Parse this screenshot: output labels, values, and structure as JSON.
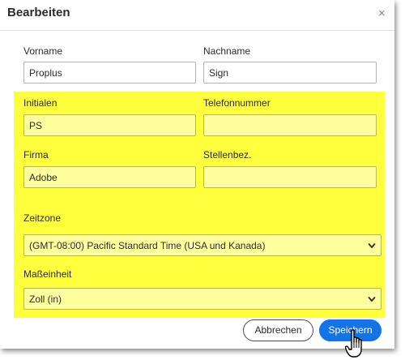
{
  "dialog": {
    "title": "Bearbeiten",
    "close_glyph": "×"
  },
  "form": {
    "vorname": {
      "label": "Vorname",
      "value": "Proplus"
    },
    "nachname": {
      "label": "Nachname",
      "value": "Sign"
    },
    "initialen": {
      "label": "Initialen",
      "value": "PS"
    },
    "telefonnummer": {
      "label": "Telefonnummer",
      "value": ""
    },
    "firma": {
      "label": "Firma",
      "value": "Adobe"
    },
    "stellenbez": {
      "label": "Stellenbez.",
      "value": ""
    },
    "zeitzone": {
      "label": "Zeitzone",
      "value": "(GMT-08:00) Pacific Standard Time (USA und Kanada)"
    },
    "masseinheit": {
      "label": "Maßeinheit",
      "value": "Zoll (in)"
    }
  },
  "buttons": {
    "cancel_label": "Abbrechen",
    "save_label": "Speichern"
  },
  "colors": {
    "highlight": "#ffff3e",
    "highlight_field": "#ffff9e",
    "primary": "#1473e6"
  },
  "icons": {
    "close": "close-icon",
    "dropdown": "chevron-down-icon",
    "cursor": "hand-pointer-icon"
  }
}
